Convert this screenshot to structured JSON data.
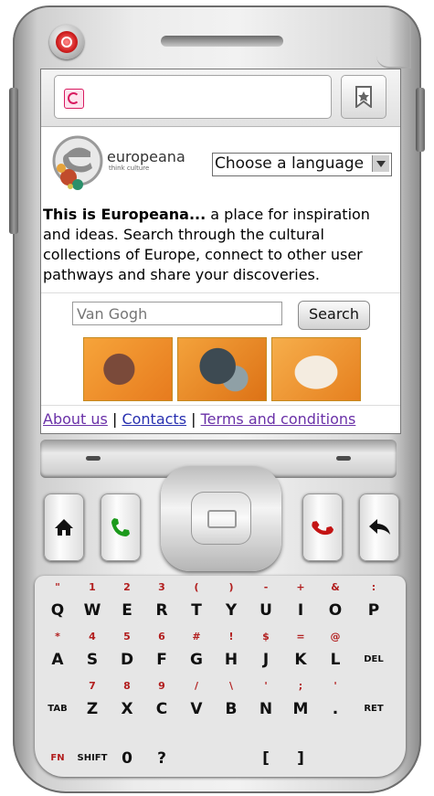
{
  "browser": {
    "url_value": "",
    "bookmark_icon": "bookmark-icon"
  },
  "site": {
    "logo_word": "europeana",
    "logo_tagline": "think culture",
    "language_select": "Choose a language",
    "intro_bold": "This is Europeana...",
    "intro_rest": " a place for inspiration and ideas. Search through the cultural collections of Europe, connect to other user pathways and share your discoveries.",
    "search_placeholder": "Van Gogh",
    "search_button": "Search",
    "links": [
      "About us",
      "Contacts",
      "Terms and conditions"
    ],
    "link_separator": "|"
  },
  "keyboard": {
    "rows": [
      [
        {
          "alt": "\"",
          "main": "Q"
        },
        {
          "alt": "1",
          "main": "W"
        },
        {
          "alt": "2",
          "main": "E"
        },
        {
          "alt": "3",
          "main": "R"
        },
        {
          "alt": "(",
          "main": "T"
        },
        {
          "alt": ")",
          "main": "Y"
        },
        {
          "alt": "-",
          "main": "U"
        },
        {
          "alt": "+",
          "main": "I"
        },
        {
          "alt": "&",
          "main": "O"
        },
        {
          "alt": ":",
          "main": "P"
        }
      ],
      [
        {
          "alt": "*",
          "main": "A"
        },
        {
          "alt": "4",
          "main": "S"
        },
        {
          "alt": "5",
          "main": "D"
        },
        {
          "alt": "6",
          "main": "F"
        },
        {
          "alt": "#",
          "main": "G"
        },
        {
          "alt": "!",
          "main": "H"
        },
        {
          "alt": "$",
          "main": "J"
        },
        {
          "alt": "=",
          "main": "K"
        },
        {
          "alt": "@",
          "main": "L"
        },
        {
          "alt": "",
          "main": "DEL"
        }
      ],
      [
        {
          "alt": "",
          "main": "TAB"
        },
        {
          "alt": "7",
          "main": "Z"
        },
        {
          "alt": "8",
          "main": "X"
        },
        {
          "alt": "9",
          "main": "C"
        },
        {
          "alt": "/",
          "main": "V"
        },
        {
          "alt": "\\",
          "main": "B"
        },
        {
          "alt": "'",
          "main": "N"
        },
        {
          "alt": ";",
          "main": "M"
        },
        {
          "alt": "'",
          "main": "."
        },
        {
          "alt": "",
          "main": "RET"
        }
      ],
      [
        {
          "alt": "",
          "main": "FN"
        },
        {
          "alt": "",
          "main": "SHIFT"
        },
        {
          "alt": "",
          "main": "0"
        },
        {
          "alt": "",
          "main": "?"
        },
        {
          "alt": "",
          "main": ""
        },
        {
          "alt": "",
          "main": ""
        },
        {
          "alt": "",
          "main": "["
        },
        {
          "alt": "",
          "main": "]"
        },
        {
          "alt": "",
          "main": ""
        },
        {
          "alt": "",
          "main": ""
        }
      ]
    ]
  },
  "colors": {
    "link": "#2830b0",
    "key_alt": "#b21e1e",
    "call_green": "#1c9a1c",
    "end_red": "#c41414",
    "power_red": "#d11f1f"
  }
}
